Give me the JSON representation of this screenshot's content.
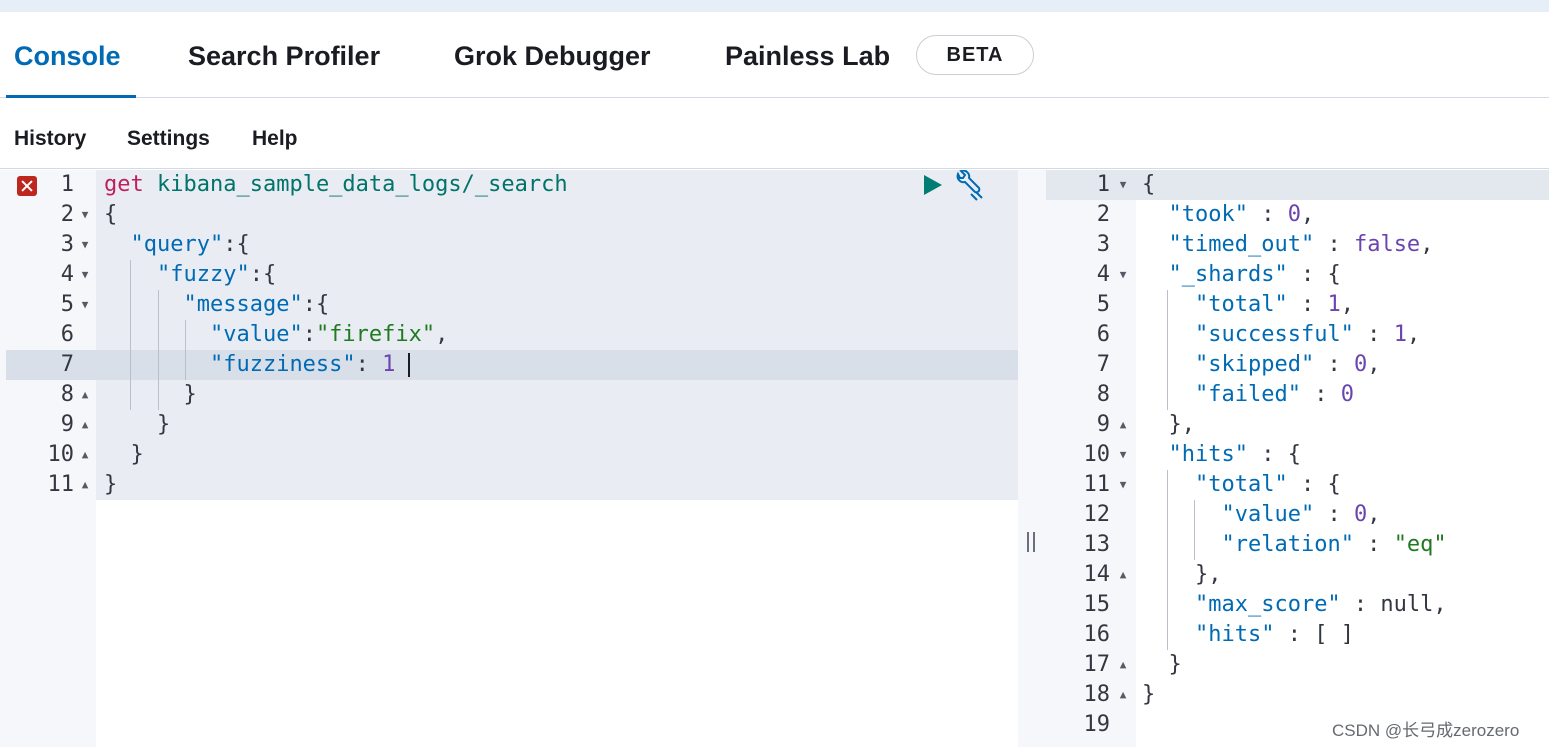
{
  "tabs": [
    {
      "label": "Console",
      "active": true
    },
    {
      "label": "Search Profiler",
      "active": false
    },
    {
      "label": "Grok Debugger",
      "active": false
    },
    {
      "label": "Painless Lab",
      "active": false
    }
  ],
  "beta_badge": "BETA",
  "menu": [
    "History",
    "Settings",
    "Help"
  ],
  "request": {
    "line_numbers": [
      "1",
      "2",
      "3",
      "4",
      "5",
      "6",
      "7",
      "8",
      "9",
      "10",
      "11"
    ],
    "method": "get",
    "url": "kibana_sample_data_logs/_search",
    "lines": {
      "l2": "{",
      "l3_key": "\"query\"",
      "l3_rest": ":{",
      "l4_key": "\"fuzzy\"",
      "l4_rest": ":{",
      "l5_key": "\"message\"",
      "l5_rest": ":{",
      "l6_key": "\"value\"",
      "l6_colon": ":",
      "l6_val": "\"firefix\"",
      "l6_comma": ",",
      "l7_key": "\"fuzziness\"",
      "l7_colon": ": ",
      "l7_val": "1",
      "l8": "}",
      "l9": "}",
      "l10": "}",
      "l11": "}"
    }
  },
  "response": {
    "line_numbers": [
      "1",
      "2",
      "3",
      "4",
      "5",
      "6",
      "7",
      "8",
      "9",
      "10",
      "11",
      "12",
      "13",
      "14",
      "15",
      "16",
      "17",
      "18",
      "19"
    ],
    "lines": {
      "o1": "{",
      "o2_key": "\"took\"",
      "o2_rest": " : ",
      "o2_val": "0",
      "o2_end": ",",
      "o3_key": "\"timed_out\"",
      "o3_rest": " : ",
      "o3_val": "false",
      "o3_end": ",",
      "o4_key": "\"_shards\"",
      "o4_rest": " : {",
      "o5_key": "\"total\"",
      "o5_rest": " : ",
      "o5_val": "1",
      "o5_end": ",",
      "o6_key": "\"successful\"",
      "o6_rest": " : ",
      "o6_val": "1",
      "o6_end": ",",
      "o7_key": "\"skipped\"",
      "o7_rest": " : ",
      "o7_val": "0",
      "o7_end": ",",
      "o8_key": "\"failed\"",
      "o8_rest": " : ",
      "o8_val": "0",
      "o9": "},",
      "o10_key": "\"hits\"",
      "o10_rest": " : {",
      "o11_key": "\"total\"",
      "o11_rest": " : {",
      "o12_key": "\"value\"",
      "o12_rest": " : ",
      "o12_val": "0",
      "o12_end": ",",
      "o13_key": "\"relation\"",
      "o13_rest": " : ",
      "o13_val": "\"eq\"",
      "o14": "},",
      "o15_key": "\"max_score\"",
      "o15_rest": " : null,",
      "o16_key": "\"hits\"",
      "o16_rest": " : [ ]",
      "o17": "}",
      "o18": "}"
    }
  },
  "watermark": "CSDN @长弓成zerozero",
  "icons": [
    "error-icon",
    "play-icon",
    "wrench-icon",
    "fold-arrow-icon",
    "resize-handle-icon"
  ],
  "colors": {
    "accent": "#006bb4",
    "method": "#bf1f5d",
    "url": "#00736a",
    "string": "#207a20",
    "error": "#bd271e",
    "run": "#017d73"
  }
}
